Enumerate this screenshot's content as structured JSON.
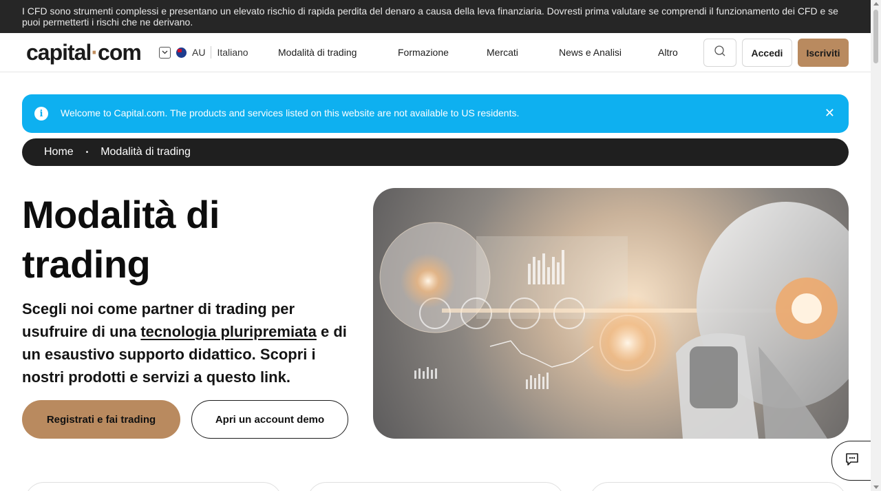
{
  "risk_banner": {
    "text": "I CFD sono strumenti complessi e presentano un elevato rischio di rapida perdita del denaro a causa della leva finanziaria. Dovresti prima valutare se comprendi il funzionamento dei CFD e se puoi permetterti i rischi che ne derivano."
  },
  "header": {
    "logo_main": "capital",
    "logo_dot": "·",
    "logo_tail": "com",
    "region": "AU",
    "language": "Italiano",
    "nav": [
      "Modalità di trading",
      "Formazione",
      "Mercati",
      "News e Analisi",
      "Altro"
    ],
    "login_label": "Accedi",
    "signup_label": "Iscriviti"
  },
  "info_bar": {
    "text": "Welcome to Capital.com. The products and services listed on this website are not available to US residents.",
    "close_symbol": "✕"
  },
  "breadcrumb": {
    "items": [
      "Home",
      "Modalità di trading"
    ],
    "separator": "•"
  },
  "hero": {
    "title": "Modalità di trading",
    "desc_before": "Scegli noi come partner di trading per usufruire di una ",
    "desc_link": "tecnologia pluripremiata",
    "desc_after": " e di un esaustivo supporto didattico. Scopri i nostri prodotti e servizi a questo link.",
    "cta_primary": "Registrati e fai trading",
    "cta_secondary": "Apri un account demo"
  },
  "colors": {
    "accent": "#b98a5f",
    "info": "#0eb0f0",
    "dark": "#1f1f1f"
  }
}
